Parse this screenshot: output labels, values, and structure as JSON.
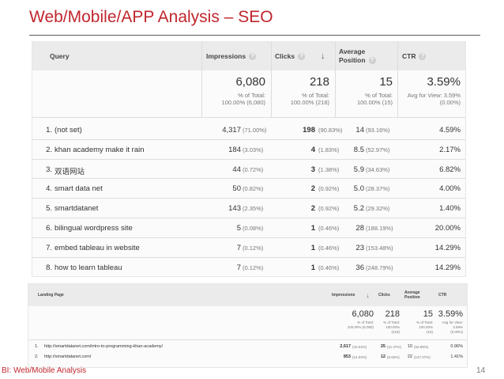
{
  "slide": {
    "title": "Web/Mobile/APP Analysis – SEO",
    "footer": "BI: Web/Mobile Analysis",
    "page_number": "14"
  },
  "table1": {
    "headers": {
      "query": "Query",
      "impressions": "Impressions",
      "clicks": "Clicks",
      "avg_position_line1": "Average",
      "avg_position_line2": "Position",
      "ctr": "CTR",
      "help": "?",
      "sort_arrow": "↓"
    },
    "totals": {
      "impressions": "6,080",
      "impressions_sub1": "% of Total:",
      "impressions_sub2": "100.00% (6,080)",
      "clicks": "218",
      "clicks_sub1": "% of Total:",
      "clicks_sub2": "100.00% (218)",
      "position": "15",
      "position_sub1": "% of Total:",
      "position_sub2": "100.00% (15)",
      "ctr": "3.59%",
      "ctr_sub1": "Avg for View: 3.59%",
      "ctr_sub2": "(0.00%)"
    },
    "rows": [
      {
        "idx": "1.",
        "query": "(not set)",
        "impressions": "4,317",
        "imp_pct": "(71.00%)",
        "clicks": "198",
        "clk_pct": "(90.83%)",
        "position": "14",
        "pos_pct": "(93.16%)",
        "ctr": "4.59%"
      },
      {
        "idx": "2.",
        "query": "khan academy make it rain",
        "impressions": "184",
        "imp_pct": "(3.03%)",
        "clicks": "4",
        "clk_pct": "(1.83%)",
        "position": "8.5",
        "pos_pct": "(52.97%)",
        "ctr": "2.17%"
      },
      {
        "idx": "3.",
        "query": "双语网站",
        "impressions": "44",
        "imp_pct": "(0.72%)",
        "clicks": "3",
        "clk_pct": "(1.38%)",
        "position": "5.9",
        "pos_pct": "(34.63%)",
        "ctr": "6.82%"
      },
      {
        "idx": "4.",
        "query": "smart data net",
        "impressions": "50",
        "imp_pct": "(0.82%)",
        "clicks": "2",
        "clk_pct": "(0.92%)",
        "position": "5.0",
        "pos_pct": "(28.37%)",
        "ctr": "4.00%"
      },
      {
        "idx": "5.",
        "query": "smartdatanet",
        "impressions": "143",
        "imp_pct": "(2.35%)",
        "clicks": "2",
        "clk_pct": "(0.92%)",
        "position": "5.2",
        "pos_pct": "(29.32%)",
        "ctr": "1.40%"
      },
      {
        "idx": "6.",
        "query": "bilingual wordpress site",
        "impressions": "5",
        "imp_pct": "(0.08%)",
        "clicks": "1",
        "clk_pct": "(0.46%)",
        "position": "28",
        "pos_pct": "(188.19%)",
        "ctr": "20.00%"
      },
      {
        "idx": "7.",
        "query": "embed tableau in website",
        "impressions": "7",
        "imp_pct": "(0.12%)",
        "clicks": "1",
        "clk_pct": "(0.46%)",
        "position": "23",
        "pos_pct": "(153.48%)",
        "ctr": "14.29%"
      },
      {
        "idx": "8.",
        "query": "how to learn tableau",
        "impressions": "7",
        "imp_pct": "(0.12%)",
        "clicks": "1",
        "clk_pct": "(0.46%)",
        "position": "36",
        "pos_pct": "(248.79%)",
        "ctr": "14.29%"
      }
    ]
  },
  "table2": {
    "headers": {
      "landing_page": "Landing Page",
      "impressions": "Impressions",
      "sort_arrow": "↓",
      "clicks": "Clicks",
      "avg_position_line1": "Average",
      "avg_position_line2": "Position",
      "ctr": "CTR"
    },
    "totals": {
      "impressions": "6,080",
      "impressions_sub1": "% of Total:",
      "impressions_sub2": "100.00% (6,080)",
      "clicks": "218",
      "clicks_sub1": "% of Total:",
      "clicks_sub2": "100.00%",
      "clicks_sub3": "(218)",
      "position": "15",
      "position_sub1": "% of Total:",
      "position_sub2": "100.00%",
      "position_sub3": "(15)",
      "ctr": "3.59%",
      "ctr_sub1": "Avg for View:",
      "ctr_sub2": "3.59%",
      "ctr_sub3": "(0.00%)"
    },
    "rows": [
      {
        "idx": "1.",
        "page": "http://smartdatanet.com/intro-to-programming-khan-academy/",
        "impressions": "2,617",
        "imp_pct": "(43.04%)",
        "clicks": "25",
        "clk_pct": "(11.47%)",
        "position": "10",
        "pos_pct": "(62.89%)",
        "ctr": "0.96%"
      },
      {
        "idx": "2.",
        "page": "http://smartdatanet.com/",
        "impressions": "853",
        "imp_pct": "(14.03%)",
        "clicks": "12",
        "clk_pct": "(5.50%)",
        "position": "22",
        "pos_pct": "(147.07%)",
        "ctr": "1.41%"
      }
    ]
  },
  "colors": {
    "title_red": "#c0262d",
    "header_gray": "#ebebeb"
  }
}
